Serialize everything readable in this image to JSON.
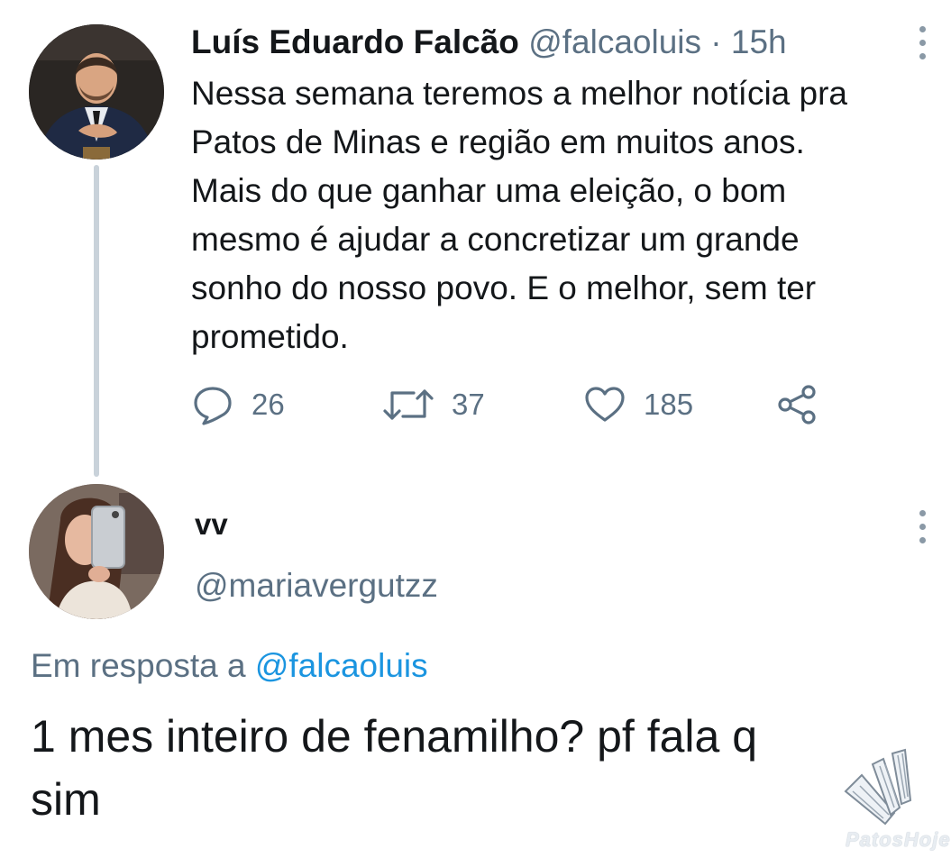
{
  "tweet": {
    "author_name": "Luís Eduardo Falcão",
    "author_handle": "@falcaoluis",
    "separator": "·",
    "time": "15h",
    "text_lines": [
      "Nessa semana teremos a melhor notícia pra",
      "Patos de Minas e região em muitos anos.",
      "Mais do que ganhar uma eleição, o bom",
      "mesmo é ajudar a concretizar um grande",
      "sonho do nosso povo. E o melhor, sem ter",
      "prometido."
    ],
    "actions": {
      "replies": "26",
      "retweets": "37",
      "likes": "185"
    }
  },
  "reply": {
    "author_name": "vv",
    "author_handle": "@mariavergutzz",
    "reply_to_prefix": "Em resposta a",
    "reply_to_handle": "@falcaoluis",
    "text_lines": [
      "1 mes inteiro de fenamilho? pf fala q",
      "sim"
    ]
  },
  "watermark": {
    "text": "PatosHoje"
  },
  "colors": {
    "text_primary": "#14171a",
    "text_secondary": "#5b7083",
    "link": "#1b95e0",
    "thread_line": "#c9d2da"
  },
  "icons": [
    "more-vertical-icon",
    "reply-icon",
    "retweet-icon",
    "like-icon",
    "share-icon",
    "watermark-logo"
  ]
}
